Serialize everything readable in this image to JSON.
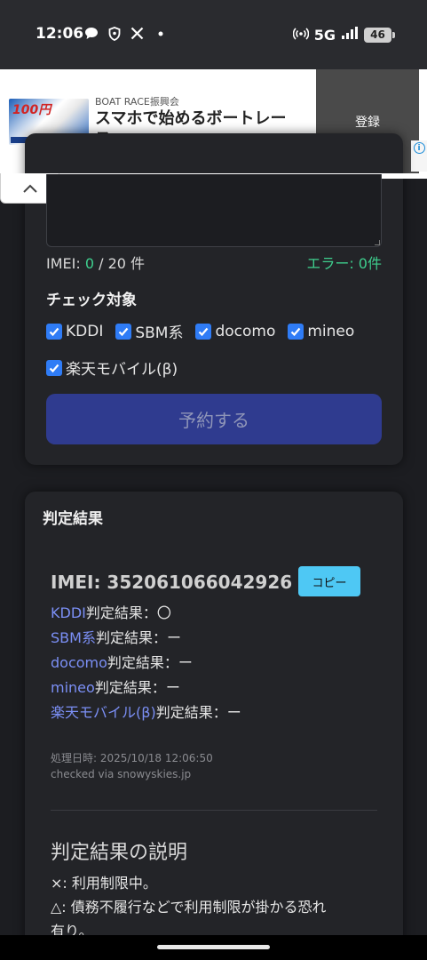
{
  "status_bar": {
    "time": "12:06",
    "icons_left": [
      "chat-bubble-icon",
      "shield-icon",
      "x-logo-icon",
      "dot-icon"
    ],
    "network": "5G",
    "battery": "46"
  },
  "ad": {
    "thumb_text": "100円",
    "source": "BOAT RACE振興会",
    "headline": "スマホで始めるボートレース",
    "cta": "登録",
    "info": "i"
  },
  "form": {
    "imei_label": "IMEI: ",
    "imei_count": "0",
    "imei_total": " / 20 件",
    "error_label": "エラー: 0件",
    "check_label": "チェック対象",
    "carriers": [
      {
        "label": "KDDI",
        "checked": true
      },
      {
        "label": "SBM系",
        "checked": true
      },
      {
        "label": "docomo",
        "checked": true
      },
      {
        "label": "mineo",
        "checked": true
      },
      {
        "label": "楽天モバイル(β)",
        "checked": true
      }
    ],
    "submit": "予約する"
  },
  "result": {
    "title": "判定結果",
    "imei": "IMEI: 352061066042926",
    "copy": "コピー",
    "lines": [
      {
        "carrier": "KDDI",
        "suffix": "判定結果：〇"
      },
      {
        "carrier": "SBM系",
        "suffix": "判定結果：ー"
      },
      {
        "carrier": "docomo",
        "suffix": "判定結果：ー"
      },
      {
        "carrier": "mineo",
        "suffix": "判定結果：ー"
      },
      {
        "carrier": "楽天モバイル(β)",
        "suffix": "判定結果：ー"
      }
    ],
    "processed": "処理日時: 2025/10/18 12:06:50",
    "checked_via": "checked via snowyskies.jp"
  },
  "explanation": {
    "title": "判定結果の説明",
    "lines": [
      "×: 利用制限中。",
      "△: 債務不履行などで利用制限が掛かる恐れ",
      "有り。"
    ]
  }
}
